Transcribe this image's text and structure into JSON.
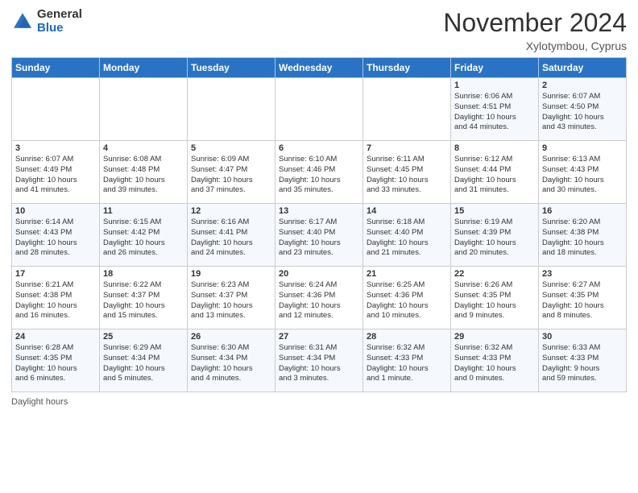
{
  "logo": {
    "general": "General",
    "blue": "Blue"
  },
  "header": {
    "month": "November 2024",
    "location": "Xylotymbou, Cyprus"
  },
  "days_of_week": [
    "Sunday",
    "Monday",
    "Tuesday",
    "Wednesday",
    "Thursday",
    "Friday",
    "Saturday"
  ],
  "footer": {
    "label": "Daylight hours"
  },
  "weeks": [
    [
      {
        "day": "",
        "info": ""
      },
      {
        "day": "",
        "info": ""
      },
      {
        "day": "",
        "info": ""
      },
      {
        "day": "",
        "info": ""
      },
      {
        "day": "",
        "info": ""
      },
      {
        "day": "1",
        "info": "Sunrise: 6:06 AM\nSunset: 4:51 PM\nDaylight: 10 hours\nand 44 minutes."
      },
      {
        "day": "2",
        "info": "Sunrise: 6:07 AM\nSunset: 4:50 PM\nDaylight: 10 hours\nand 43 minutes."
      }
    ],
    [
      {
        "day": "3",
        "info": "Sunrise: 6:07 AM\nSunset: 4:49 PM\nDaylight: 10 hours\nand 41 minutes."
      },
      {
        "day": "4",
        "info": "Sunrise: 6:08 AM\nSunset: 4:48 PM\nDaylight: 10 hours\nand 39 minutes."
      },
      {
        "day": "5",
        "info": "Sunrise: 6:09 AM\nSunset: 4:47 PM\nDaylight: 10 hours\nand 37 minutes."
      },
      {
        "day": "6",
        "info": "Sunrise: 6:10 AM\nSunset: 4:46 PM\nDaylight: 10 hours\nand 35 minutes."
      },
      {
        "day": "7",
        "info": "Sunrise: 6:11 AM\nSunset: 4:45 PM\nDaylight: 10 hours\nand 33 minutes."
      },
      {
        "day": "8",
        "info": "Sunrise: 6:12 AM\nSunset: 4:44 PM\nDaylight: 10 hours\nand 31 minutes."
      },
      {
        "day": "9",
        "info": "Sunrise: 6:13 AM\nSunset: 4:43 PM\nDaylight: 10 hours\nand 30 minutes."
      }
    ],
    [
      {
        "day": "10",
        "info": "Sunrise: 6:14 AM\nSunset: 4:43 PM\nDaylight: 10 hours\nand 28 minutes."
      },
      {
        "day": "11",
        "info": "Sunrise: 6:15 AM\nSunset: 4:42 PM\nDaylight: 10 hours\nand 26 minutes."
      },
      {
        "day": "12",
        "info": "Sunrise: 6:16 AM\nSunset: 4:41 PM\nDaylight: 10 hours\nand 24 minutes."
      },
      {
        "day": "13",
        "info": "Sunrise: 6:17 AM\nSunset: 4:40 PM\nDaylight: 10 hours\nand 23 minutes."
      },
      {
        "day": "14",
        "info": "Sunrise: 6:18 AM\nSunset: 4:40 PM\nDaylight: 10 hours\nand 21 minutes."
      },
      {
        "day": "15",
        "info": "Sunrise: 6:19 AM\nSunset: 4:39 PM\nDaylight: 10 hours\nand 20 minutes."
      },
      {
        "day": "16",
        "info": "Sunrise: 6:20 AM\nSunset: 4:38 PM\nDaylight: 10 hours\nand 18 minutes."
      }
    ],
    [
      {
        "day": "17",
        "info": "Sunrise: 6:21 AM\nSunset: 4:38 PM\nDaylight: 10 hours\nand 16 minutes."
      },
      {
        "day": "18",
        "info": "Sunrise: 6:22 AM\nSunset: 4:37 PM\nDaylight: 10 hours\nand 15 minutes."
      },
      {
        "day": "19",
        "info": "Sunrise: 6:23 AM\nSunset: 4:37 PM\nDaylight: 10 hours\nand 13 minutes."
      },
      {
        "day": "20",
        "info": "Sunrise: 6:24 AM\nSunset: 4:36 PM\nDaylight: 10 hours\nand 12 minutes."
      },
      {
        "day": "21",
        "info": "Sunrise: 6:25 AM\nSunset: 4:36 PM\nDaylight: 10 hours\nand 10 minutes."
      },
      {
        "day": "22",
        "info": "Sunrise: 6:26 AM\nSunset: 4:35 PM\nDaylight: 10 hours\nand 9 minutes."
      },
      {
        "day": "23",
        "info": "Sunrise: 6:27 AM\nSunset: 4:35 PM\nDaylight: 10 hours\nand 8 minutes."
      }
    ],
    [
      {
        "day": "24",
        "info": "Sunrise: 6:28 AM\nSunset: 4:35 PM\nDaylight: 10 hours\nand 6 minutes."
      },
      {
        "day": "25",
        "info": "Sunrise: 6:29 AM\nSunset: 4:34 PM\nDaylight: 10 hours\nand 5 minutes."
      },
      {
        "day": "26",
        "info": "Sunrise: 6:30 AM\nSunset: 4:34 PM\nDaylight: 10 hours\nand 4 minutes."
      },
      {
        "day": "27",
        "info": "Sunrise: 6:31 AM\nSunset: 4:34 PM\nDaylight: 10 hours\nand 3 minutes."
      },
      {
        "day": "28",
        "info": "Sunrise: 6:32 AM\nSunset: 4:33 PM\nDaylight: 10 hours\nand 1 minute."
      },
      {
        "day": "29",
        "info": "Sunrise: 6:32 AM\nSunset: 4:33 PM\nDaylight: 10 hours\nand 0 minutes."
      },
      {
        "day": "30",
        "info": "Sunrise: 6:33 AM\nSunset: 4:33 PM\nDaylight: 9 hours\nand 59 minutes."
      }
    ]
  ]
}
